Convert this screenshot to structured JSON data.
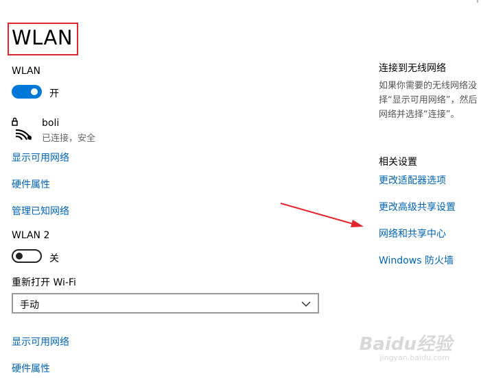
{
  "page": {
    "title": "WLAN"
  },
  "wlan1": {
    "label": "WLAN",
    "toggle_state": "开",
    "toggle_on": true,
    "network": {
      "ssid": "boli",
      "status": "已连接，安全"
    },
    "links": [
      "显示可用网络",
      "硬件属性",
      "管理已知网络"
    ]
  },
  "wlan2": {
    "label": "WLAN 2",
    "toggle_state": "关",
    "toggle_on": false,
    "reopen_label": "重新打开 Wi-Fi",
    "reopen_value": "手动",
    "links": [
      "显示可用网络",
      "硬件属性"
    ]
  },
  "right": {
    "connect_heading": "连接到无线网络",
    "connect_desc_lines": [
      "如果你需要的无线网络没",
      "择“显示可用网络”，然后",
      "网络并选择“连接”。"
    ],
    "related_heading": "相关设置",
    "related_links": [
      "更改适配器选项",
      "更改高级共享设置",
      "网络和共享中心",
      "Windows 防火墙"
    ]
  },
  "watermark": {
    "brand": "Baidu经验",
    "url": "jingyan.baidu.com"
  },
  "colors": {
    "accent": "#0078d7",
    "link": "#0063b1",
    "highlight_box": "#e0262b",
    "arrow": "#e0262b"
  }
}
